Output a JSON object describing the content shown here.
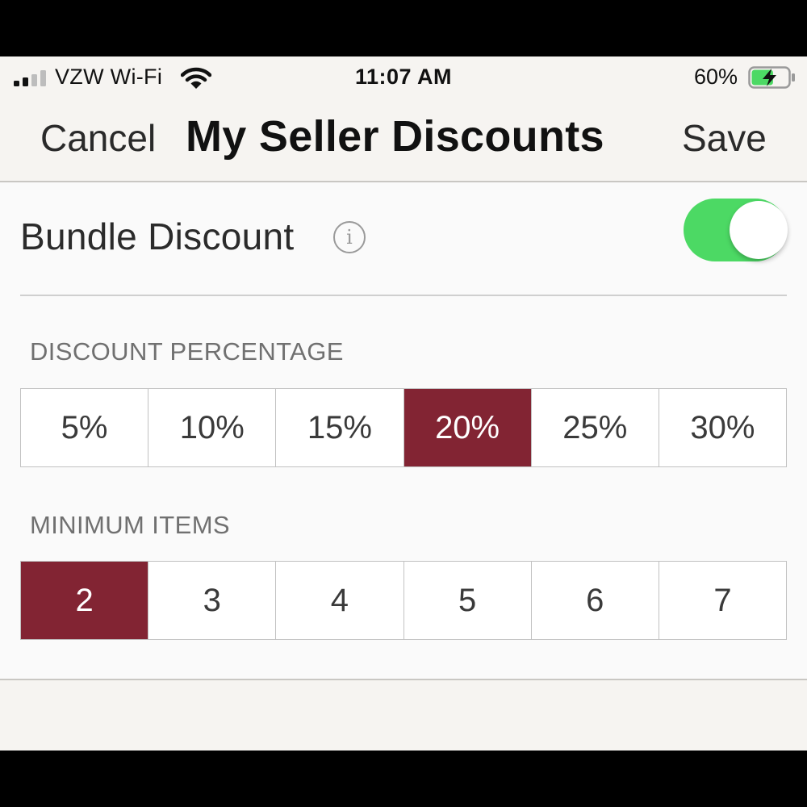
{
  "status_bar": {
    "carrier": "VZW Wi-Fi",
    "time": "11:07 AM",
    "battery_percent": "60%",
    "battery_level": 0.6,
    "charging": true,
    "signal_bars_active": 2,
    "signal_bars_total": 4
  },
  "nav": {
    "cancel_label": "Cancel",
    "title": "My Seller Discounts",
    "save_label": "Save"
  },
  "bundle": {
    "label": "Bundle Discount",
    "info_icon": "info-icon",
    "enabled": true
  },
  "discount_percentage": {
    "header": "DISCOUNT PERCENTAGE",
    "options": [
      "5%",
      "10%",
      "15%",
      "20%",
      "25%",
      "30%"
    ],
    "selected": "20%"
  },
  "minimum_items": {
    "header": "MINIMUM ITEMS",
    "options": [
      "2",
      "3",
      "4",
      "5",
      "6",
      "7"
    ],
    "selected": "2"
  },
  "colors": {
    "accent": "#822433",
    "toggle_on": "#4cd964",
    "battery_fill": "#4cd964",
    "nav_bg": "#f6f4f1",
    "content_bg": "#fafafa"
  }
}
